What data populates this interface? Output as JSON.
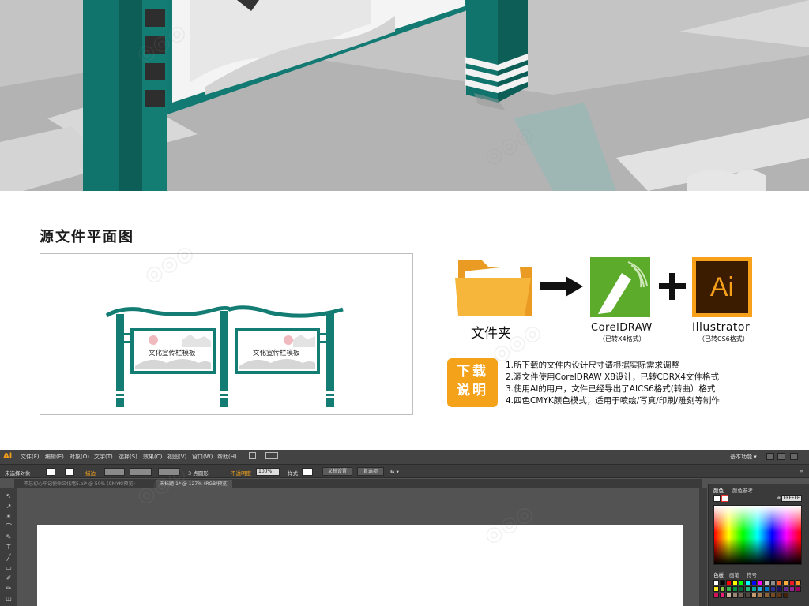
{
  "flat_section": {
    "title": "源文件平面图",
    "panel_left_text": "文化宣传栏模板",
    "panel_right_text": "文化宣传栏模板"
  },
  "download_info": {
    "folder_label": "文件夹",
    "coreldraw_label": "CorelDRAW",
    "coreldraw_sub": "（已转X4格式）",
    "illustrator_label": "Illustrator",
    "illustrator_sub": "（已转CS6格式）",
    "ai_icon_text": "Ai",
    "badge_line1": "下载",
    "badge_line2": "说明",
    "notes": [
      "1.所下载的文件内设计尺寸请根据实际需求调整",
      "2.源文件使用CorelDRAW X8设计，已转CDRX4文件格式",
      "3.使用AI的用户，文件已经导出了AICS6格式(转曲）格式",
      "4.四色CMYK颜色模式，适用于喷绘/写真/印刷/雕刻等制作"
    ],
    "colors": {
      "folder": "#f6b63c",
      "corel": "#5dab2b",
      "ai_bg": "#f7a11a",
      "ai_text": "#3b1c00",
      "badge": "#f3a21a"
    }
  },
  "illustrator": {
    "logo": "Ai",
    "menus": [
      "文件(F)",
      "编辑(E)",
      "对象(O)",
      "文字(T)",
      "选择(S)",
      "效果(C)",
      "视图(V)",
      "窗口(W)",
      "帮助(H)"
    ],
    "workspace_label": "基本功能 ▾",
    "options": {
      "selection_state": "未选择对象",
      "stroke_label": "描边",
      "points_label": "3 点圆形",
      "opacity_label": "不透明度",
      "opacity_value": "100%",
      "style_label": "样式",
      "doc_setup_button": "文档设置",
      "preferences_button": "首选项"
    },
    "tabs": [
      {
        "label": "不忘初心牢记使命文化墙5.ai* @ 50% (CMYK/预览)"
      },
      {
        "label": "未标题-1* @ 127% (RGB/预览)"
      }
    ],
    "color_panel": {
      "tab_color": "颜色",
      "tab_guide": "颜色参考",
      "hex_value": "FFFFFF"
    },
    "swatch_panel": {
      "tab_swatches": "色板",
      "tab_brushes": "画笔",
      "tab_symbols": "符号"
    },
    "swatch_colors": [
      "#ffffff",
      "#000000",
      "#ff0000",
      "#ffff00",
      "#00ff00",
      "#00ffff",
      "#0000ff",
      "#ff00ff",
      "#c6c6c6",
      "#8c8c8c",
      "#f15a24",
      "#fbb03b",
      "#ed1c24",
      "#f7931e",
      "#fcee21",
      "#8cc63f",
      "#39b54a",
      "#009245",
      "#006837",
      "#22b573",
      "#00a99d",
      "#29abe2",
      "#0071bc",
      "#2e3192",
      "#1b1464",
      "#662d91",
      "#93278f",
      "#9e005d",
      "#d4145a",
      "#ed1e79",
      "#c7b299",
      "#998675",
      "#736357",
      "#534741",
      "#c69c6d",
      "#a67c52",
      "#8c6239",
      "#754c24",
      "#603813",
      "#42210b"
    ]
  }
}
